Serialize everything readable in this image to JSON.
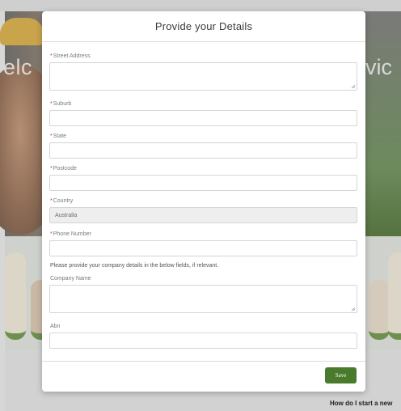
{
  "background": {
    "hero_left_text": "elc",
    "hero_right_text": "vic",
    "faq_link": "How do I start a new"
  },
  "modal": {
    "title": "Provide your Details",
    "fields": {
      "street": {
        "required_marker": "*",
        "label": "Street Address",
        "value": ""
      },
      "suburb": {
        "required_marker": "*",
        "label": "Suburb",
        "value": ""
      },
      "state": {
        "required_marker": "*",
        "label": "State",
        "value": ""
      },
      "postcode": {
        "required_marker": "*",
        "label": "Postcode",
        "value": ""
      },
      "country": {
        "required_marker": "*",
        "label": "Country",
        "value": "Australia"
      },
      "phone": {
        "required_marker": "*",
        "label": "Phone Number",
        "value": ""
      },
      "company": {
        "label": "Company Name",
        "value": ""
      },
      "abn": {
        "label": "Abn",
        "value": ""
      }
    },
    "company_helper": "Please provide your company details in the below fields, if relevant.",
    "save_label": "Save"
  },
  "colors": {
    "save_button": "#4a7a2b",
    "required_marker": "#c23934"
  }
}
